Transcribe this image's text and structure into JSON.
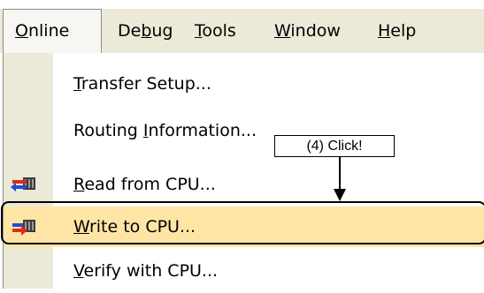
{
  "menubar": {
    "items": [
      {
        "name": "menu-online",
        "pre": "",
        "key": "O",
        "post": "nline"
      },
      {
        "name": "menu-debug",
        "pre": "De",
        "key": "b",
        "post": "ug"
      },
      {
        "name": "menu-tools",
        "pre": "",
        "key": "T",
        "post": "ools"
      },
      {
        "name": "menu-window",
        "pre": "",
        "key": "W",
        "post": "indow"
      },
      {
        "name": "menu-help",
        "pre": "",
        "key": "H",
        "post": "elp"
      }
    ]
  },
  "dropdown": {
    "items": [
      {
        "name": "transfer-setup",
        "pre": "",
        "key": "T",
        "post": "ransfer Setup..."
      },
      {
        "name": "routing-information",
        "pre": "Routing ",
        "key": "I",
        "post": "nformation..."
      },
      {
        "name": "read-from-cpu",
        "pre": "",
        "key": "R",
        "post": "ead from CPU...",
        "icon": "read-from-cpu-icon"
      },
      {
        "name": "write-to-cpu",
        "pre": "",
        "key": "W",
        "post": "rite to CPU...",
        "icon": "write-to-cpu-icon",
        "highlighted": true
      },
      {
        "name": "verify-with-cpu",
        "pre": "",
        "key": "V",
        "post": "erify with CPU..."
      }
    ]
  },
  "annotation": {
    "callout": "(4) Click!"
  },
  "colors": {
    "menubar_bg": "#ece9d8",
    "highlight": "#ffe5a5",
    "read_arrow": "#1c4fd0",
    "write_arrow": "#e02a1a"
  }
}
